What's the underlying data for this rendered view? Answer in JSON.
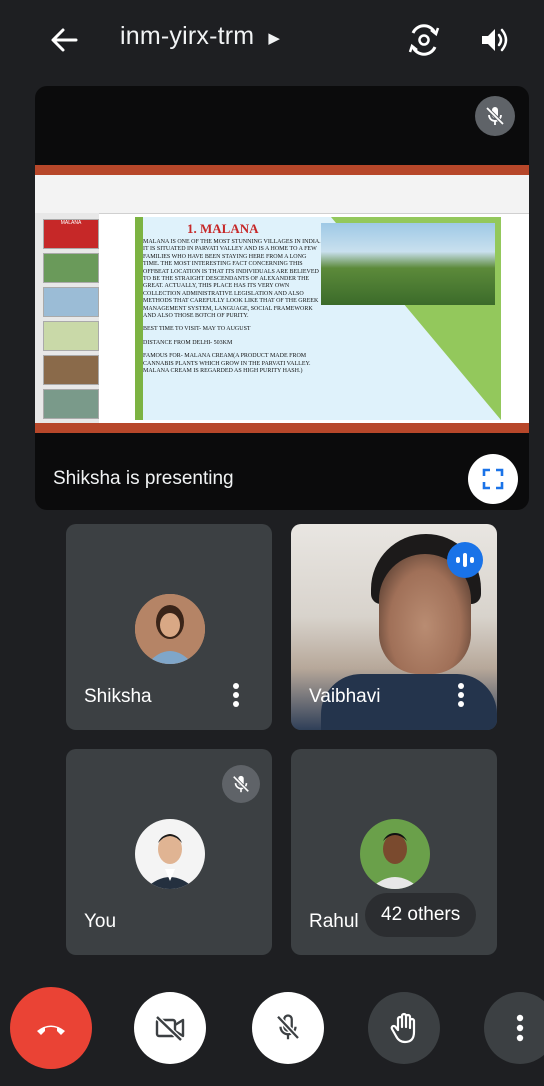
{
  "header": {
    "meeting_code": "inm-yirx-trm",
    "back_icon": "arrow-left-icon",
    "expand_icon": "triangle-right-icon",
    "switch_camera_icon": "switch-camera-icon",
    "speaker_icon": "speaker-icon"
  },
  "presentation": {
    "presenting_label": "Shiksha is presenting",
    "slide_title": "1. MALANA",
    "slide_text_1": "Malana is one of the most stunning villages in India. It is situated in Parvati Valley and is a home to a few families who have been staying here from a long time. The most interesting fact concerning this offbeat location is that its individuals are believed to be the straight descendants of Alexander the Great. Actually, this place has its very own collection administrative legislation and also methods that carefully look like that of the Greek management system, language, social framework and also those botch of purity.",
    "slide_text_2": "Best time to visit- May to August",
    "slide_text_3": "Distance from Delhi- 503km",
    "slide_text_4": "Famous for- Malana Cream(A product made from cannabis plants which grow in the Parvati Valley. Malana Cream is regarded as high purity hash.)",
    "thumbnail_label": "MALANA"
  },
  "participants": [
    {
      "name": "Shiksha",
      "muted": false
    },
    {
      "name": "Vaibhavi",
      "talking": true
    },
    {
      "name": "You",
      "muted": true
    },
    {
      "name": "Rahul",
      "others": "42 others"
    }
  ],
  "controls": {
    "end_call": "end-call-icon",
    "camera": "camera-off-icon",
    "mic": "mic-off-icon",
    "hand": "raise-hand-icon",
    "more": "more-vertical-icon"
  },
  "colors": {
    "end_call": "#ea4335",
    "talking_badge": "#1a73e8",
    "background": "#1e1f22"
  }
}
